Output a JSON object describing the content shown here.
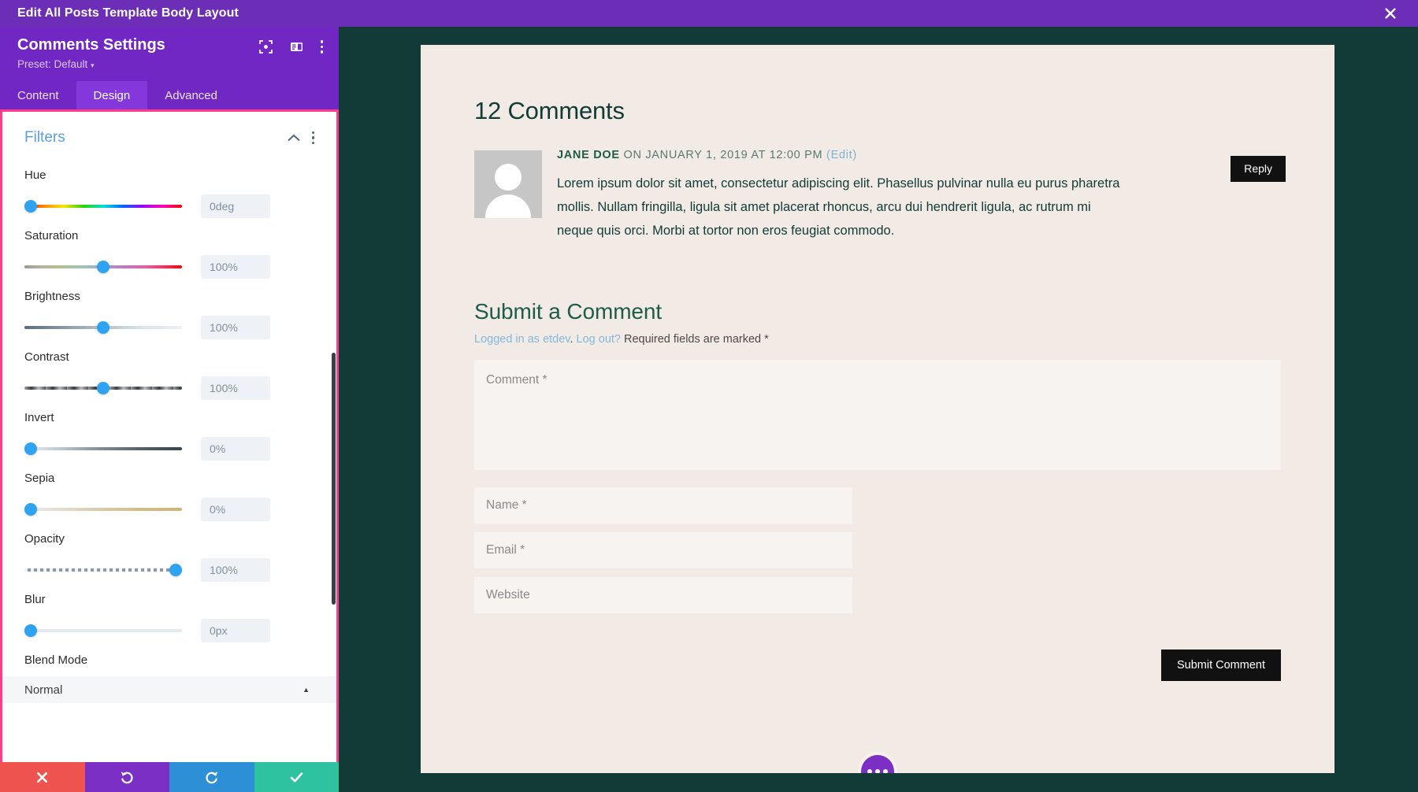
{
  "topbar": {
    "title": "Edit All Posts Template Body Layout",
    "close_icon": "close-icon"
  },
  "panel": {
    "title": "Comments Settings",
    "preset_label": "Preset: Default",
    "preset_caret": "▾",
    "head_icons": [
      "responsive-preview-icon",
      "layout-toggle-icon",
      "more-options-icon"
    ],
    "tabs": [
      {
        "label": "Content",
        "active": false
      },
      {
        "label": "Design",
        "active": true
      },
      {
        "label": "Advanced",
        "active": false
      }
    ],
    "section": {
      "title": "Filters",
      "collapse_icon": "chevron-up-icon",
      "more_icon": "more-options-icon"
    },
    "controls": [
      {
        "label": "Hue",
        "value": "0deg",
        "pct": 0,
        "track": "t-hue"
      },
      {
        "label": "Saturation",
        "value": "100%",
        "pct": 50,
        "track": "t-sat"
      },
      {
        "label": "Brightness",
        "value": "100%",
        "pct": 50,
        "track": "t-bri"
      },
      {
        "label": "Contrast",
        "value": "100%",
        "pct": 50,
        "track": "t-con"
      },
      {
        "label": "Invert",
        "value": "0%",
        "pct": 0,
        "track": "t-inv"
      },
      {
        "label": "Sepia",
        "value": "0%",
        "pct": 0,
        "track": "t-sep"
      },
      {
        "label": "Opacity",
        "value": "100%",
        "pct": 96,
        "track": "t-opa"
      },
      {
        "label": "Blur",
        "value": "0px",
        "pct": 0,
        "track": "t-blur"
      }
    ],
    "blend_mode": {
      "label": "Blend Mode",
      "value": "Normal",
      "arrow": "▲"
    }
  },
  "actionbar": [
    {
      "name": "cancel-button",
      "icon": "close-icon",
      "class": "act-cancel"
    },
    {
      "name": "undo-button",
      "icon": "undo-icon",
      "class": "act-undo"
    },
    {
      "name": "redo-button",
      "icon": "redo-icon",
      "class": "act-redo"
    },
    {
      "name": "save-button",
      "icon": "check-icon",
      "class": "act-save"
    }
  ],
  "preview": {
    "comments_title": "12 Comments",
    "comment": {
      "author": "JANE DOE",
      "meta": " ON JANUARY 1, 2019 AT 12:00 PM ",
      "edit_link": "(Edit)",
      "text": "Lorem ipsum dolor sit amet, consectetur adipiscing elit. Phasellus pulvinar nulla eu purus pharetra mollis. Nullam fringilla, ligula sit amet placerat rhoncus, arcu dui hendrerit ligula, ac rutrum mi neque quis orci. Morbi at tortor non eros feugiat commodo.",
      "reply_label": "Reply"
    },
    "form": {
      "title": "Submit a Comment",
      "logged_in_prefix": "Logged in as etdev",
      "logged_in_sep": ". ",
      "logout_label": "Log out?",
      "required_note": " Required fields are marked *",
      "comment_placeholder": "Comment *",
      "name_placeholder": "Name *",
      "email_placeholder": "Email *",
      "website_placeholder": "Website",
      "submit_label": "Submit Comment"
    },
    "fab_icon": "more-options-icon"
  },
  "colors": {
    "purple": "#7127c4",
    "topbar_purple": "#6c2eb7",
    "pink_border": "#ff3d8a",
    "canvas_dark": "#123b38",
    "page_bg": "#f2eae4",
    "accent_blue": "#2ea3f2"
  }
}
